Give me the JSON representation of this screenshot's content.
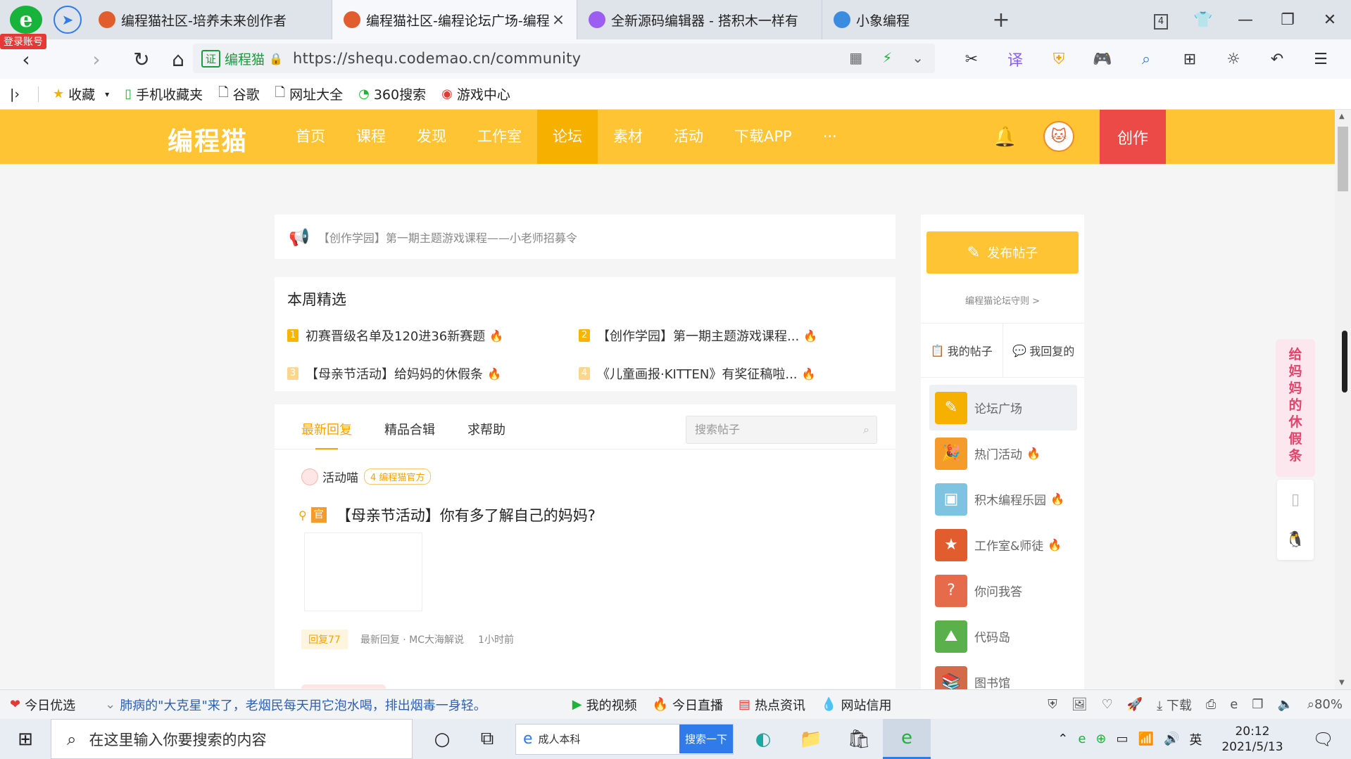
{
  "browser": {
    "login_badge": "登录账号",
    "tabs": [
      {
        "label": "编程猫社区-培养未来创作者",
        "active": false,
        "color": "#e25d2e"
      },
      {
        "label": "编程猫社区-编程论坛广场-编程",
        "active": true,
        "color": "#e25d2e"
      },
      {
        "label": "全新源码编辑器 - 搭积木一样有",
        "active": false,
        "color": "#9c5ef0"
      },
      {
        "label": "小象编程",
        "active": false,
        "color": "#3b8be0"
      }
    ],
    "tab_count": "4",
    "address": {
      "cert_label": "证",
      "cert_name": "编程猫",
      "url": "https://shequ.codemao.cn/community"
    },
    "bookmarks": [
      {
        "icon": "star-icon",
        "label": "收藏"
      },
      {
        "icon": "phone-icon",
        "label": "手机收藏夹"
      },
      {
        "icon": "doc-icon",
        "label": "谷歌"
      },
      {
        "icon": "doc-icon",
        "label": "网址大全"
      },
      {
        "icon": "360-icon",
        "label": "360搜索"
      },
      {
        "icon": "game-icon",
        "label": "游戏中心"
      }
    ]
  },
  "site": {
    "logo": "编程猫",
    "nav": [
      "首页",
      "课程",
      "发现",
      "工作室",
      "论坛",
      "素材",
      "活动",
      "下载APP",
      "···"
    ],
    "active_nav": "论坛",
    "create_label": "创作",
    "brand_color": "#fec433"
  },
  "notice": {
    "text": "【创作学园】第一期主题游戏课程——小老师招募令"
  },
  "weekly": {
    "title": "本周精选",
    "items": [
      {
        "rank": "1",
        "text": "初赛晋级名单及120进36新赛题"
      },
      {
        "rank": "2",
        "text": "【创作学园】第一期主题游戏课程..."
      },
      {
        "rank": "3",
        "text": "【母亲节活动】给妈妈的休假条"
      },
      {
        "rank": "4",
        "text": "《儿童画报·KITTEN》有奖征稿啦..."
      }
    ]
  },
  "feed": {
    "tabs": [
      "最新回复",
      "精品合辑",
      "求帮助"
    ],
    "active_tab": "最新回复",
    "search_placeholder": "搜索帖子",
    "post": {
      "author": "活动喵",
      "badge_level": "4",
      "badge": "编程猫官方",
      "tag": "官",
      "title": "【母亲节活动】你有多了解自己的妈妈?",
      "reply": "回复77",
      "latest": "最新回复 · MC大海解说",
      "time": "1小时前"
    }
  },
  "sidebar": {
    "publish": "发布帖子",
    "rules": "编程猫论坛守则 >",
    "my_posts": "我的帖子",
    "my_replies": "我回复的",
    "menu": [
      {
        "label": "论坛广场",
        "hot": false,
        "active": true,
        "color": "#f5b000"
      },
      {
        "label": "热门活动",
        "hot": true,
        "active": false,
        "color": "#f59b2a"
      },
      {
        "label": "积木编程乐园",
        "hot": true,
        "active": false,
        "color": "#7ec4e0"
      },
      {
        "label": "工作室&师徒",
        "hot": true,
        "active": false,
        "color": "#e25d2e"
      },
      {
        "label": "你问我答",
        "hot": false,
        "active": false,
        "color": "#e66b4a"
      },
      {
        "label": "代码岛",
        "hot": false,
        "active": false,
        "color": "#5ab04a"
      },
      {
        "label": "图书馆",
        "hot": false,
        "active": false,
        "color": "#d46a4a"
      }
    ]
  },
  "promo": {
    "chars": [
      "给",
      "妈",
      "妈",
      "的",
      "休",
      "假",
      "条"
    ]
  },
  "statusbar": {
    "today": "今日优选",
    "news": "肺病的\"大克星\"来了，老烟民每天用它泡水喝，排出烟毒一身轻。",
    "video": "我的视频",
    "live": "今日直播",
    "hot": "热点资讯",
    "credit": "网站信用",
    "download": "下载",
    "zoom": "80%"
  },
  "taskbar": {
    "search_placeholder": "在这里输入你要搜索的内容",
    "ie_text": "成人本科",
    "ie_button": "搜索一下",
    "ime": "英",
    "time": "20:12",
    "date": "2021/5/13"
  }
}
